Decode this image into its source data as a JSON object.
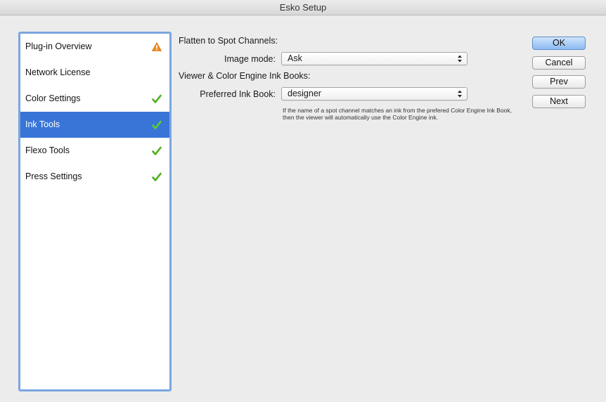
{
  "window": {
    "title": "Esko Setup"
  },
  "sidebar": {
    "items": [
      {
        "label": "Plug-in Overview",
        "status": "warning-icon",
        "selected": false
      },
      {
        "label": "Network License",
        "status": "",
        "selected": false
      },
      {
        "label": "Color Settings",
        "status": "checkmark-icon",
        "selected": false
      },
      {
        "label": "Ink Tools",
        "status": "checkmark-icon",
        "selected": true
      },
      {
        "label": "Flexo Tools",
        "status": "checkmark-icon",
        "selected": false
      },
      {
        "label": "Press Settings",
        "status": "checkmark-icon",
        "selected": false
      }
    ]
  },
  "main": {
    "flatten_heading": "Flatten to Spot Channels:",
    "image_mode_label": "Image mode:",
    "image_mode_value": "Ask",
    "viewer_heading": "Viewer & Color Engine Ink Books:",
    "ink_book_label": "Preferred Ink Book:",
    "ink_book_value": "designer",
    "help_text": "If the name of a spot channel matches an ink from the prefered Color Engine Ink Book, then the viewer will automatically use the Color Engine ink."
  },
  "buttons": {
    "ok": "OK",
    "cancel": "Cancel",
    "prev": "Prev",
    "next": "Next"
  },
  "colors": {
    "selection": "#3875d7",
    "check": "#4caf1a",
    "warning": "#f08a1c"
  }
}
